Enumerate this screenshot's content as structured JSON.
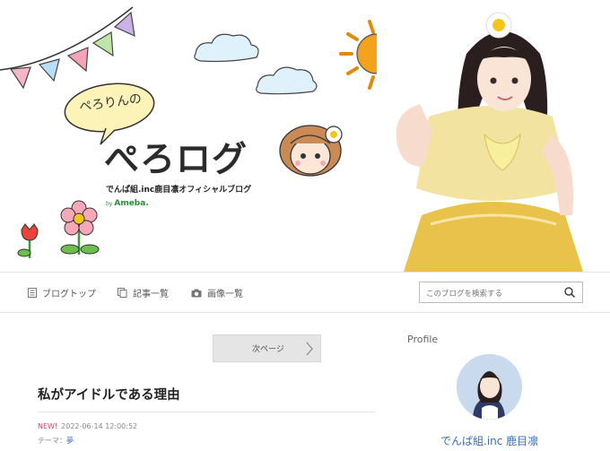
{
  "header": {
    "bubble_text": "ぺろりんの",
    "title": "ぺろログ",
    "subtitle": "でんぱ組.inc鹿目凛オフィシャルブログ",
    "by_label": "by",
    "ameba_label": "Ameba."
  },
  "nav": {
    "top_label": "ブログトップ",
    "entries_label": "記事一覧",
    "images_label": "画像一覧",
    "search_placeholder": "このブログを検索する"
  },
  "main": {
    "next_page_label": "次ページ",
    "entry": {
      "title": "私がアイドルである理由",
      "new_badge": "NEW!",
      "datetime": "2022-06-14 12:00:52",
      "theme_label": "テーマ：",
      "theme_value": "夢"
    }
  },
  "sidebar": {
    "profile_heading": "Profile",
    "profile_name": "でんぱ組.inc 鹿目凛"
  },
  "colors": {
    "link_blue": "#3a6cb8",
    "new_pink": "#d23f6c",
    "ameba_green": "#2d8c3c",
    "sun_orange": "#f4a21b",
    "costume_gold": "#e8c24a"
  }
}
